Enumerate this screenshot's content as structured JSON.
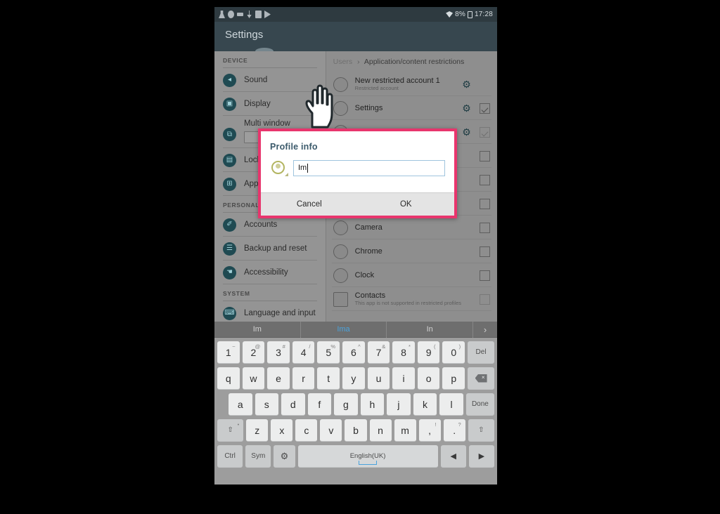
{
  "status_bar": {
    "icons": [
      "person-icon",
      "globe-icon",
      "sim-icon",
      "download-icon",
      "sd-card-icon",
      "play-icon"
    ],
    "wifi_icon": "wifi-icon",
    "battery_text": "8%",
    "battery_icon": "battery-icon",
    "time": "17:28"
  },
  "action_bar": {
    "title": "Settings"
  },
  "sidebar": {
    "sections": [
      {
        "header": "DEVICE",
        "items": [
          {
            "label": "Sound",
            "icon": "sound-icon",
            "glyph": "◂"
          },
          {
            "label": "Display",
            "icon": "display-icon",
            "glyph": "▣"
          },
          {
            "label": "Multi window",
            "icon": "multi-window-icon",
            "glyph": "⧉",
            "toggle": true
          },
          {
            "label": "Lock screen",
            "icon": "lock-screen-icon",
            "glyph": "▤"
          },
          {
            "label": "Applications",
            "icon": "applications-icon",
            "glyph": "⊞"
          }
        ]
      },
      {
        "header": "PERSONAL",
        "items": [
          {
            "label": "Accounts",
            "icon": "accounts-icon",
            "glyph": "✐"
          },
          {
            "label": "Backup and reset",
            "icon": "backup-reset-icon",
            "glyph": "☰"
          },
          {
            "label": "Accessibility",
            "icon": "accessibility-icon",
            "glyph": "☚"
          }
        ]
      },
      {
        "header": "SYSTEM",
        "items": [
          {
            "label": "Language and input",
            "icon": "language-input-icon",
            "glyph": "⌨"
          }
        ]
      }
    ]
  },
  "content": {
    "breadcrumb": {
      "parent": "Users",
      "separator": "›",
      "current": "Application/content restrictions"
    },
    "rows": [
      {
        "title": "New restricted account 1",
        "subtitle": "Restricted account",
        "icon": "account-avatar-icon",
        "gear": true,
        "checkbox": "none"
      },
      {
        "title": "Settings",
        "subtitle": "",
        "icon": "settings-app-icon",
        "gear": true,
        "checkbox": "checked"
      },
      {
        "title": "",
        "subtitle": "",
        "icon": "app-icon",
        "gear": true,
        "checkbox": "checked-ghost"
      },
      {
        "title": "",
        "subtitle": "",
        "icon": "app-icon",
        "gear": false,
        "checkbox": "unchecked"
      },
      {
        "title": "",
        "subtitle": "",
        "icon": "app-icon",
        "gear": false,
        "checkbox": "unchecked"
      },
      {
        "title": "",
        "subtitle": "",
        "icon": "app-icon",
        "gear": false,
        "checkbox": "unchecked"
      },
      {
        "title": "Camera",
        "subtitle": "",
        "icon": "camera-app-icon",
        "gear": false,
        "checkbox": "unchecked"
      },
      {
        "title": "Chrome",
        "subtitle": "",
        "icon": "chrome-app-icon",
        "gear": false,
        "checkbox": "unchecked"
      },
      {
        "title": "Clock",
        "subtitle": "",
        "icon": "clock-app-icon",
        "gear": false,
        "checkbox": "unchecked"
      },
      {
        "title": "Contacts",
        "subtitle": "This app is not supported in restricted profiles",
        "icon": "contacts-app-icon",
        "gear": false,
        "checkbox": "ghost"
      }
    ]
  },
  "dialog": {
    "title": "Profile info",
    "avatar_icon": "profile-avatar-icon",
    "input_value": "Im",
    "input_placeholder": "",
    "cancel_label": "Cancel",
    "ok_label": "OK",
    "highlight_color": "#e8356d"
  },
  "cursor": {
    "icon": "hand-pointer-cursor"
  },
  "keyboard": {
    "suggestions": [
      {
        "text": "Im",
        "active": false
      },
      {
        "text": "Ima",
        "active": true
      },
      {
        "text": "In",
        "active": false
      }
    ],
    "more_arrow": "›",
    "rows": [
      [
        {
          "main": "1",
          "sup": "~"
        },
        {
          "main": "2",
          "sup": "@"
        },
        {
          "main": "3",
          "sup": "#"
        },
        {
          "main": "4",
          "sup": "/"
        },
        {
          "main": "5",
          "sup": "%"
        },
        {
          "main": "6",
          "sup": "^"
        },
        {
          "main": "7",
          "sup": "&"
        },
        {
          "main": "8",
          "sup": "*"
        },
        {
          "main": "9",
          "sup": "("
        },
        {
          "main": "0",
          "sup": ")"
        },
        {
          "main": "Del",
          "sup": "",
          "type": "fn"
        }
      ],
      [
        {
          "main": "q"
        },
        {
          "main": "w"
        },
        {
          "main": "e"
        },
        {
          "main": "r"
        },
        {
          "main": "t"
        },
        {
          "main": "y"
        },
        {
          "main": "u"
        },
        {
          "main": "i"
        },
        {
          "main": "o"
        },
        {
          "main": "p"
        },
        {
          "main": "",
          "type": "backspace",
          "icon": "backspace-icon"
        }
      ],
      [
        {
          "main": "a"
        },
        {
          "main": "s"
        },
        {
          "main": "d"
        },
        {
          "main": "f"
        },
        {
          "main": "g"
        },
        {
          "main": "h"
        },
        {
          "main": "j"
        },
        {
          "main": "k"
        },
        {
          "main": "l"
        },
        {
          "main": "Done",
          "type": "fn"
        }
      ],
      [
        {
          "main": "⇧",
          "sup": "•",
          "type": "fn-shift",
          "icon": "shift-icon"
        },
        {
          "main": "z"
        },
        {
          "main": "x"
        },
        {
          "main": "c"
        },
        {
          "main": "v"
        },
        {
          "main": "b"
        },
        {
          "main": "n"
        },
        {
          "main": "m"
        },
        {
          "main": ",",
          "sup": "!"
        },
        {
          "main": ".",
          "sup": "?"
        },
        {
          "main": "⇧",
          "type": "fn-shift",
          "icon": "shift-icon"
        }
      ],
      [
        {
          "main": "Ctrl",
          "type": "fn"
        },
        {
          "main": "Sym",
          "type": "fn"
        },
        {
          "main": "⚙",
          "type": "gear",
          "icon": "keyboard-settings-icon"
        },
        {
          "main": "English(UK)",
          "type": "space"
        },
        {
          "main": "◀",
          "type": "arrow",
          "icon": "arrow-left-icon"
        },
        {
          "main": "▶",
          "type": "arrow",
          "icon": "arrow-right-icon"
        }
      ]
    ]
  }
}
